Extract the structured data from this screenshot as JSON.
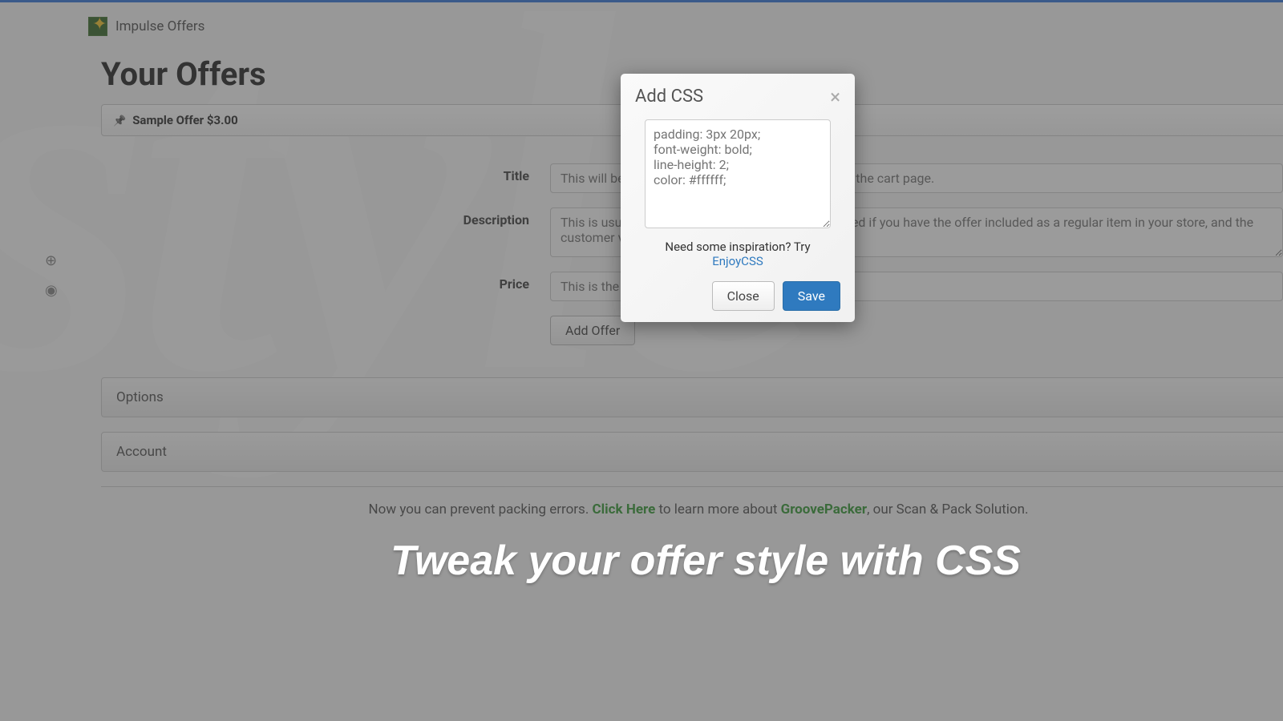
{
  "header": {
    "app_name": "Impulse Offers"
  },
  "page": {
    "title": "Your Offers"
  },
  "offer_bar": {
    "label": "Sample Offer $3.00"
  },
  "form": {
    "title": {
      "label": "Title",
      "placeholder": "This will be the offer text that the customer sees on the cart page."
    },
    "description": {
      "label": "Description",
      "placeholder": "This is usually left blank. Description is only displayed if you have the offer included as a regular item in your store, and the customer views the product page."
    },
    "price": {
      "label": "Price",
      "placeholder": "This is the price of the offer."
    },
    "add_button": "Add Offer"
  },
  "sections": {
    "options": "Options",
    "account": "Account"
  },
  "footer": {
    "prefix": "Now you can prevent packing errors. ",
    "click": "Click Here",
    "mid": " to learn more about ",
    "product": "GroovePacker",
    "suffix": ", our Scan & Pack Solution."
  },
  "modal": {
    "title": "Add CSS",
    "css_placeholder": "padding: 3px 20px;\nfont-weight: bold;\nline-height: 2;\ncolor: #ffffff;",
    "hint_text": "Need some inspiration? Try",
    "hint_link": "EnjoyCSS",
    "close": "Close",
    "save": "Save"
  },
  "tagline": "Tweak your offer style with CSS"
}
